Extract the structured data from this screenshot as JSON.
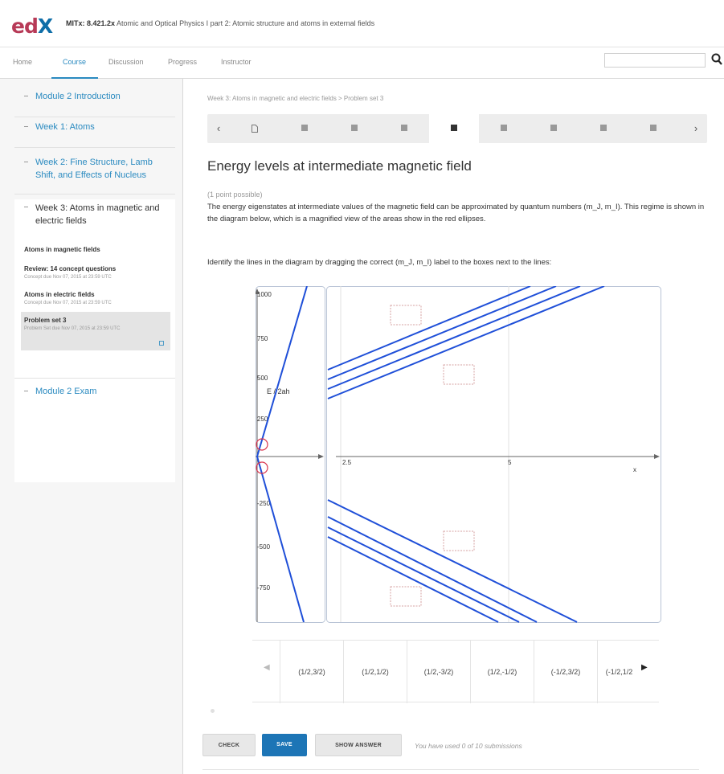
{
  "header": {
    "logo_ed": "ed",
    "logo_x": "X",
    "course_code": "MITx: 8.421.2x",
    "course_name": "Atomic and Optical Physics I part 2: Atomic structure and atoms in external fields"
  },
  "nav": {
    "tabs": [
      "Home",
      "Course",
      "Discussion",
      "Progress",
      "Instructor"
    ],
    "active_tab": "Course",
    "search_placeholder": ""
  },
  "sidebar": {
    "chapters": [
      {
        "label": "Module 2 Introduction"
      },
      {
        "label": "Week 1: Atoms"
      },
      {
        "label": "Week 2: Fine Structure, Lamb Shift, and Effects of Nucleus"
      },
      {
        "label": "Week 3: Atoms in magnetic and electric fields"
      },
      {
        "label": "Module 2 Exam"
      }
    ],
    "sequences": [
      {
        "title": "Atoms in magnetic fields",
        "subtitle": ""
      },
      {
        "title": "Review: 14 concept questions",
        "subtitle": "Concept due Nov 07, 2015 at 23:59 UTC"
      },
      {
        "title": "Atoms in electric fields",
        "subtitle": "Concept due Nov 07, 2015 at 23:59 UTC"
      },
      {
        "title": "Problem set 3",
        "subtitle": "Problem Set due Nov 07, 2015 at 23:59 UTC"
      }
    ]
  },
  "main": {
    "breadcrumb": "Week 3: Atoms in magnetic and electric fields > Problem set 3",
    "problem_title": "Energy levels at intermediate magnetic field",
    "points": "(1 point possible)",
    "description": "The energy eigenstates at intermediate values of the magnetic field can be approximated by quantum numbers (m_J, m_I). This regime is shown in the diagram below, which is a magnified view of the areas show in the red ellipses.",
    "instruction": "Identify the lines in the diagram by dragging the correct (m_J, m_I) label to the boxes next to the lines:",
    "diagram": {
      "ylabel": "E / 2ah",
      "xlabel": "x",
      "y_ticks": [
        "1000",
        "750",
        "500",
        "250",
        "-250",
        "-500",
        "-750"
      ],
      "x_ticks": [
        "2.5",
        "5"
      ]
    },
    "drag_labels": [
      "(1/2,3/2)",
      "(1/2,1/2)",
      "(1/2,-3/2)",
      "(1/2,-1/2)",
      "(-1/2,3/2)",
      "(-1/2,1/2"
    ],
    "buttons": {
      "check": "CHECK",
      "save": "SAVE",
      "show_answer": "SHOW ANSWER"
    },
    "submissions": "You have used 0 of 10 submissions"
  },
  "colors": {
    "accent": "#2a8ac0",
    "save_button": "#1d75b6",
    "diagram_line": "#1f4fd8",
    "ellipse": "#d9344d"
  }
}
